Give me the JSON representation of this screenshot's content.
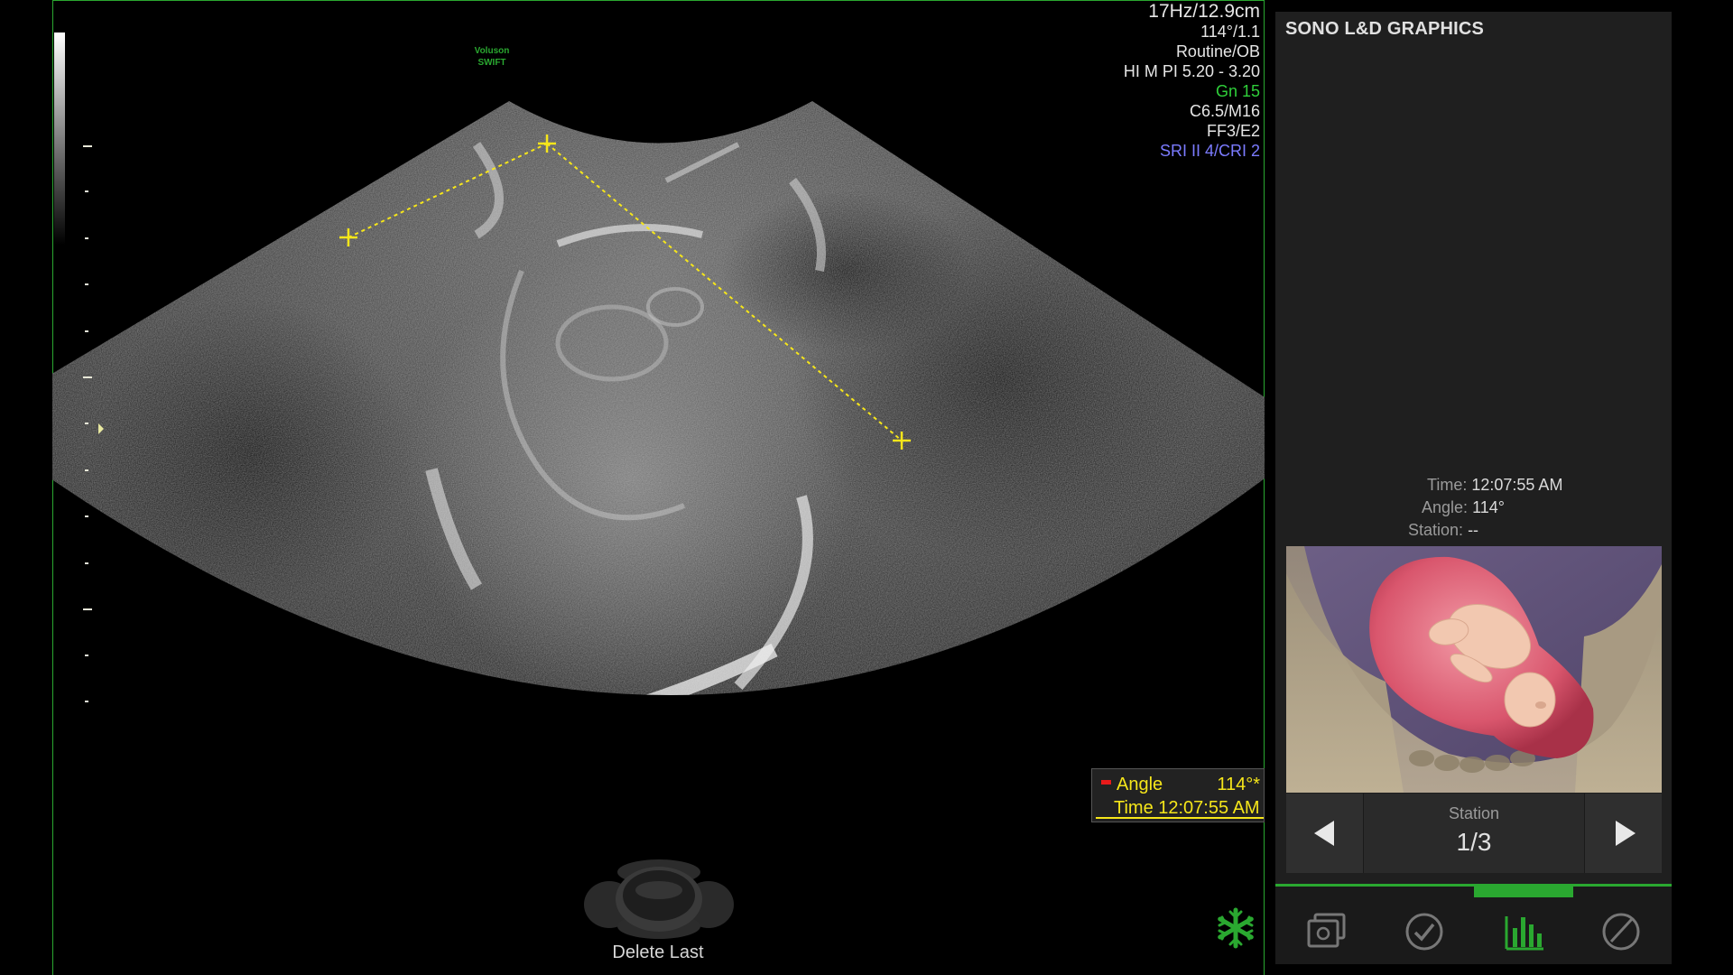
{
  "logo": {
    "line1": "Voluson",
    "line2": "SWIFT"
  },
  "params": [
    {
      "text": "17Hz/12.9cm",
      "color": "#e6e6e6"
    },
    {
      "text": "114°/1.1",
      "color": "#e6e6e6"
    },
    {
      "text": "Routine/OB",
      "color": "#e6e6e6"
    },
    {
      "text": "HI M PI 5.20 - 3.20",
      "color": "#e6e6e6"
    },
    {
      "text": "Gn  15",
      "color": "#2fcf3a"
    },
    {
      "text": "C6.5/M16",
      "color": "#e6e6e6"
    },
    {
      "text": "FF3/E2",
      "color": "#e6e6e6"
    },
    {
      "text": "SRI II 4/CRI 2",
      "color": "#7b7bff"
    }
  ],
  "measurement": {
    "angle_label": "Angle",
    "angle_value": "114°*",
    "time_label": "Time 12:07:55 AM"
  },
  "trackball": {
    "label": "Delete Last"
  },
  "panel": {
    "title": "SONO L&D GRAPHICS",
    "time_label": "Time:",
    "time_value": "12:07:55 AM",
    "angle_label": "Angle:",
    "angle_value": "114°",
    "station_label": "Station:",
    "station_value": "--",
    "station_nav_label": "Station",
    "station_nav_value": "1/3"
  },
  "tabs": [
    {
      "name": "image-tab",
      "icon": "photo-stack-icon",
      "active": false
    },
    {
      "name": "check-tab",
      "icon": "checkmark-icon",
      "active": false
    },
    {
      "name": "chart-tab",
      "icon": "bar-chart-icon",
      "active": true
    },
    {
      "name": "angle-tab",
      "icon": "angle-gauge-icon",
      "active": false
    }
  ],
  "colors": {
    "accent_green": "#2aa830",
    "caliper_yellow": "#f6e61a",
    "panel_bg": "#1f1f1f"
  }
}
